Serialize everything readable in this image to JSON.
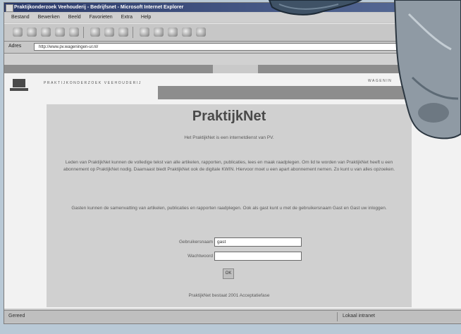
{
  "browser": {
    "title": "Praktijkonderzoek Veehouderij - Bedrijfsnet - Microsoft Internet Explorer",
    "menu": [
      "Bestand",
      "Bewerken",
      "Beeld",
      "Favorieten",
      "Extra",
      "Help"
    ],
    "address_label": "Adres",
    "address_value": "http://www.pv.wageningen-ur.nl/",
    "status_left": "Gereed",
    "status_right": "Lokaal intranet"
  },
  "site": {
    "logo_text": "PRAKTIJKONDERZOEK VEEHOUDERIJ",
    "nav_label": "WAGENIN",
    "title": "PraktijkNet",
    "intro": "Het PraktijkNet is een internetdienst van PV.",
    "paragraph1": "Leden van PraktijkNet kunnen de volledige tekst van alle artikelen, rapporten, publicaties, lees en maak raadplegen. Om lid te worden van PraktijkNet heeft u een abonnement op PraktijkNet nodig. Daarnaast biedt PraktijkNet ook de digitale KWIN. Hiervoor moet u een apart abonnement nemen. Zo kunt u van alles opzoeken.",
    "paragraph2": "Gasten kunnen de samenvatting van artikelen, publicaties en rapporten raadplegen. Ook als gast kunt u met de gebruikersnaam Gast en Gast uw inloggen.",
    "form": {
      "username_label": "Gebruikersnaam",
      "username_value": "gast",
      "password_label": "Wachtwoord",
      "password_value": "",
      "submit_label": "OK"
    },
    "footer": "PraktijkNet bestaat 2001 Acceptatiefase"
  }
}
